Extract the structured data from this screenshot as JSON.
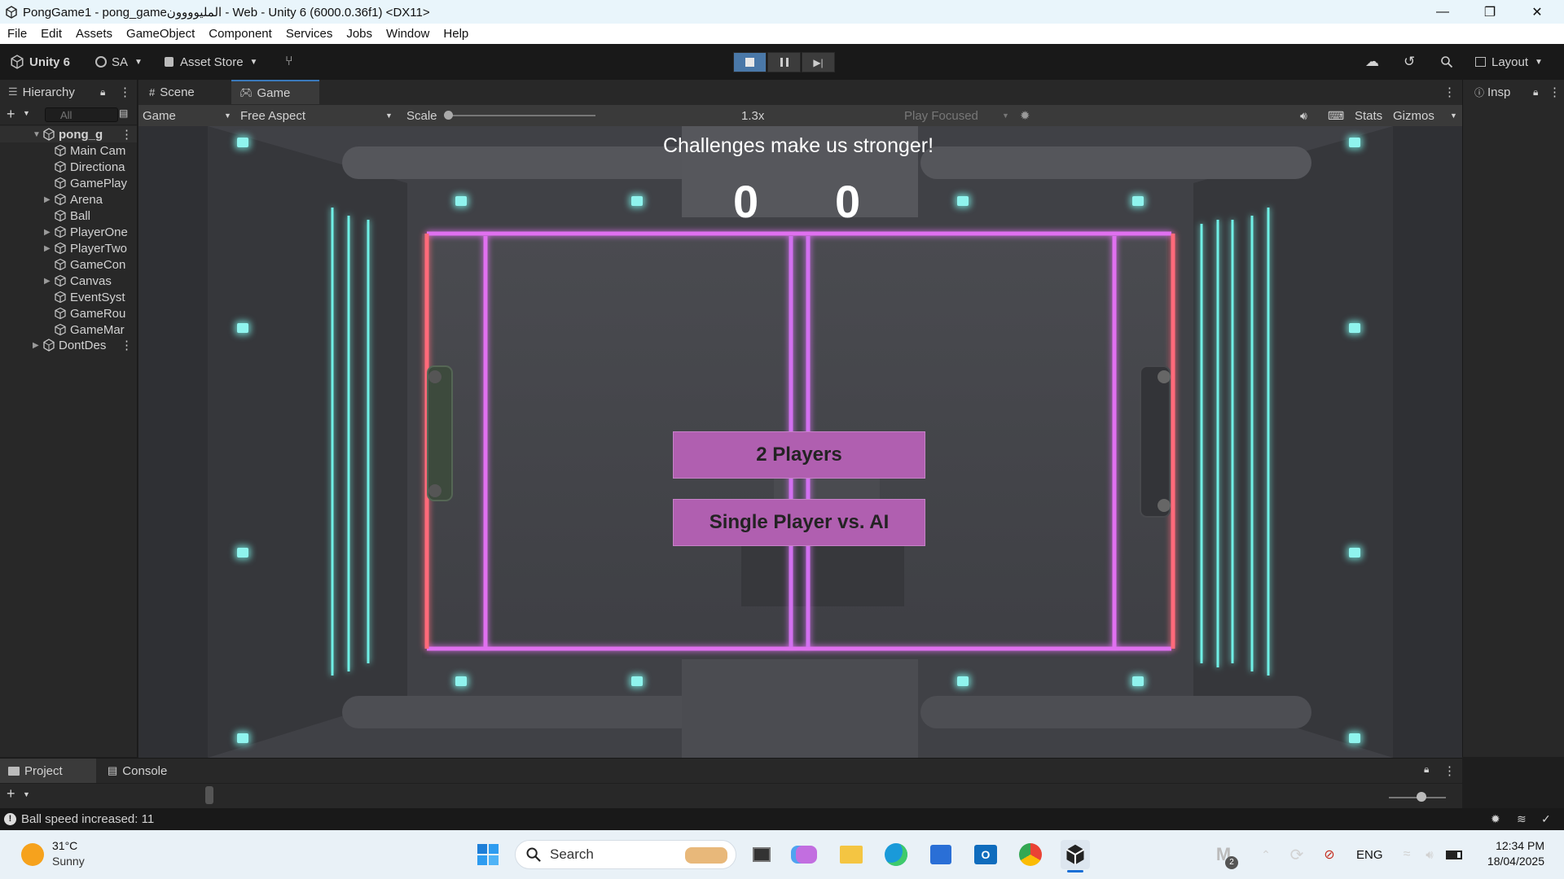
{
  "window": {
    "title": "PongGame1 - pong_gameالمليوووون - Web - Unity 6 (6000.0.36f1) <DX11>",
    "minimize": "—",
    "maximize": "❐",
    "close": "✕"
  },
  "menu": [
    "File",
    "Edit",
    "Assets",
    "GameObject",
    "Component",
    "Services",
    "Jobs",
    "Window",
    "Help"
  ],
  "toolbar": {
    "unity_label": "Unity 6",
    "account_label": "SA",
    "asset_store_label": "Asset Store",
    "layout_label": "Layout"
  },
  "hierarchy": {
    "tab_label": "Hierarchy",
    "search_placeholder": "All",
    "scene_name": "pong_g",
    "items": [
      {
        "label": "Main Cam",
        "expandable": false
      },
      {
        "label": "Directiona",
        "expandable": false
      },
      {
        "label": "GamePlay",
        "expandable": false
      },
      {
        "label": "Arena",
        "expandable": true
      },
      {
        "label": "Ball",
        "expandable": false
      },
      {
        "label": "PlayerOne",
        "expandable": true
      },
      {
        "label": "PlayerTwo",
        "expandable": true
      },
      {
        "label": "GameCon",
        "expandable": false
      },
      {
        "label": "Canvas",
        "expandable": true
      },
      {
        "label": "EventSyst",
        "expandable": false
      },
      {
        "label": "GameRou",
        "expandable": false
      },
      {
        "label": "GameMar",
        "expandable": false
      }
    ],
    "dontdestroy": "DontDes"
  },
  "tabs": {
    "scene": "Scene",
    "game": "Game",
    "inspector": "Insp"
  },
  "gametoolbar": {
    "display": "Game",
    "aspect": "Free Aspect",
    "scale_label": "Scale",
    "scale_value": "1.3x",
    "play_mode": "Play Focused",
    "stats": "Stats",
    "gizmos": "Gizmos"
  },
  "game": {
    "challenge_text": "Challenges make us stronger!",
    "score_left": "0",
    "score_right": "0",
    "btn_two_players": "2 Players",
    "btn_single_ai": "Single Player vs. AI"
  },
  "bottom": {
    "project_tab": "Project",
    "console_tab": "Console"
  },
  "status": {
    "message": "Ball speed increased: 11"
  },
  "taskbar": {
    "temperature": "31°C",
    "weather": "Sunny",
    "search_placeholder": "Search",
    "language": "ENG",
    "time": "12:34 PM",
    "date": "18/04/2025",
    "notification_count": "2"
  },
  "colors": {
    "accent_blue": "#4a78a8",
    "neon_pink": "#e070f0",
    "neon_red": "#ff6a7a",
    "neon_cyan": "#6ff0e6",
    "button_purple": "#b05fb0"
  }
}
